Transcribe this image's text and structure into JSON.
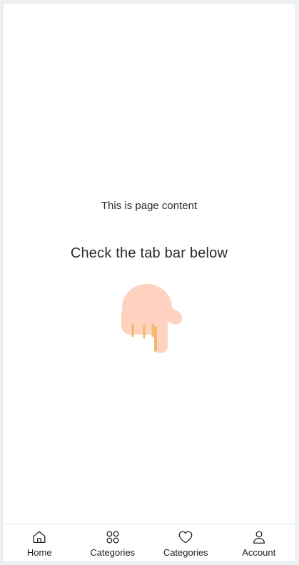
{
  "page": {
    "content_text": "This is page content",
    "hint_text": "Check the tab bar below"
  },
  "tabbar": {
    "tabs": [
      {
        "label": "Home",
        "icon": "home-icon"
      },
      {
        "label": "Categories",
        "icon": "grid-icon"
      },
      {
        "label": "Categories",
        "icon": "heart-icon"
      },
      {
        "label": "Account",
        "icon": "user-icon"
      }
    ]
  },
  "colors": {
    "hand_skin": "#ffd2c0",
    "hand_shade": "#f0b96a",
    "text": "#2b2b2b",
    "divider": "#e1e4e8"
  }
}
